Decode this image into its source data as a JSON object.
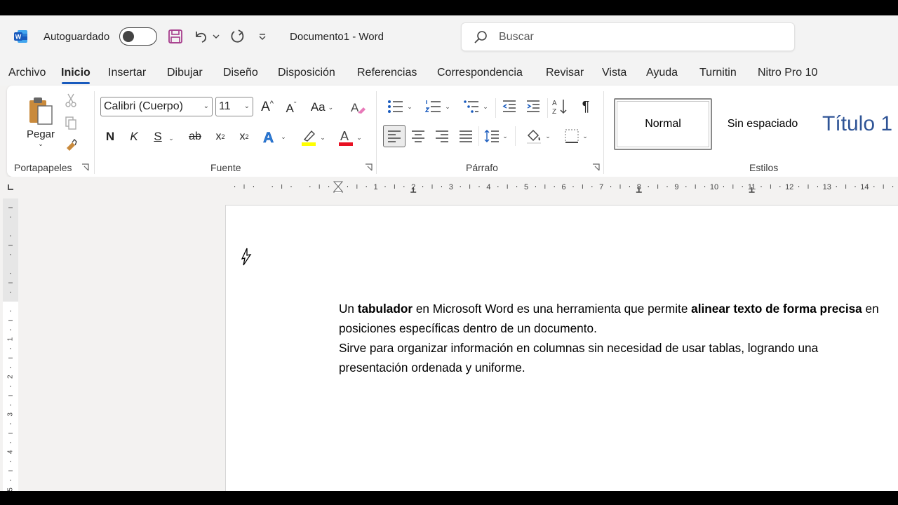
{
  "titlebar": {
    "autosave_label": "Autoguardado",
    "doc_name": "Documento1",
    "separator": " - ",
    "app_name": "Word",
    "search_placeholder": "Buscar"
  },
  "tabs": [
    {
      "label": "Archivo"
    },
    {
      "label": "Inicio",
      "active": true
    },
    {
      "label": "Insertar"
    },
    {
      "label": "Dibujar"
    },
    {
      "label": "Diseño"
    },
    {
      "label": "Disposición"
    },
    {
      "label": "Referencias"
    },
    {
      "label": "Correspondencia"
    },
    {
      "label": "Revisar"
    },
    {
      "label": "Vista"
    },
    {
      "label": "Ayuda"
    },
    {
      "label": "Turnitin"
    },
    {
      "label": "Nitro Pro 10"
    }
  ],
  "ribbon": {
    "clipboard": {
      "paste_label": "Pegar",
      "group_label": "Portapapeles"
    },
    "font": {
      "font_name": "Calibri (Cuerpo)",
      "font_size": "11",
      "bold": "N",
      "italic": "K",
      "underline": "S",
      "strike": "ab",
      "subscript": "x",
      "subscript_mark": "2",
      "superscript": "x",
      "superscript_mark": "2",
      "group_label": "Fuente",
      "highlight_color": "#ffff00",
      "font_color": "#e81123"
    },
    "paragraph": {
      "group_label": "Párrafo",
      "pilcrow": "¶"
    },
    "styles": {
      "group_label": "Estilos",
      "items": [
        {
          "label": "Normal"
        },
        {
          "label": "Sin espaciado"
        },
        {
          "label": "Título 1"
        }
      ]
    }
  },
  "ruler": {
    "numbers": [
      "1",
      "2",
      "3",
      "4",
      "5",
      "6",
      "7",
      "8",
      "9",
      "10",
      "11",
      "12",
      "13",
      "14"
    ],
    "vnumbers": [
      "1",
      "2",
      "3",
      "4",
      "5"
    ]
  },
  "document": {
    "p1_a": "Un ",
    "p1_b": "tabulador",
    "p1_c": " en Microsoft Word es una herramienta que permite ",
    "p1_d": "alinear texto de forma precisa",
    "p1_e": " en posiciones específicas dentro de un documento.",
    "p2": "Sirve para organizar información en columnas sin necesidad de usar tablas, logrando una presentación ordenada y uniforme."
  },
  "colors": {
    "accent": "#185abd",
    "word_blue": "#185abd",
    "title_style": "#2f5496"
  }
}
